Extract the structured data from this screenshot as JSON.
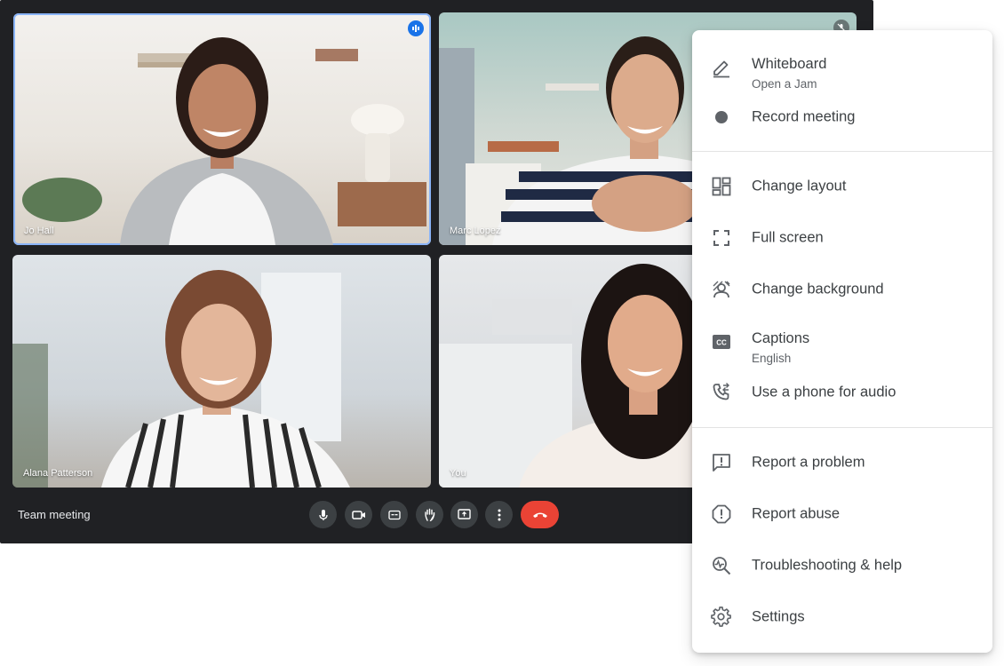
{
  "meeting": {
    "title": "Team meeting",
    "participants": [
      {
        "name": "Jo Hall"
      },
      {
        "name": "Marc Lopez"
      },
      {
        "name": "Alana Patterson"
      },
      {
        "name": "You"
      }
    ]
  },
  "controls": [
    {
      "icon": "microphone-icon"
    },
    {
      "icon": "camera-icon"
    },
    {
      "icon": "captions-icon"
    },
    {
      "icon": "raise-hand-icon"
    },
    {
      "icon": "present-screen-icon"
    },
    {
      "icon": "more-options-icon"
    },
    {
      "icon": "end-call-icon"
    }
  ],
  "menu": {
    "items": [
      {
        "label": "Whiteboard",
        "sublabel": "Open a Jam",
        "icon": "pen-icon"
      },
      {
        "label": "Record meeting",
        "icon": "record-icon"
      },
      {
        "label": "Change layout",
        "icon": "layout-icon"
      },
      {
        "label": "Full screen",
        "icon": "fullscreen-icon"
      },
      {
        "label": "Change background",
        "icon": "background-icon"
      },
      {
        "label": "Captions",
        "sublabel": "English",
        "icon": "captions-icon"
      },
      {
        "label": "Use a phone for audio",
        "icon": "phone-audio-icon"
      },
      {
        "label": "Report a problem",
        "icon": "report-problem-icon"
      },
      {
        "label": "Report abuse",
        "icon": "report-abuse-icon"
      },
      {
        "label": "Troubleshooting & help",
        "icon": "troubleshooting-icon"
      },
      {
        "label": "Settings",
        "icon": "settings-icon"
      }
    ]
  },
  "colors": {
    "window_bg": "#202124",
    "control_bg": "#3c4043",
    "end_call": "#ea4335",
    "speaking_outline": "#8ab4f8",
    "menu_text": "#3c4043",
    "menu_icon": "#5f6368"
  }
}
